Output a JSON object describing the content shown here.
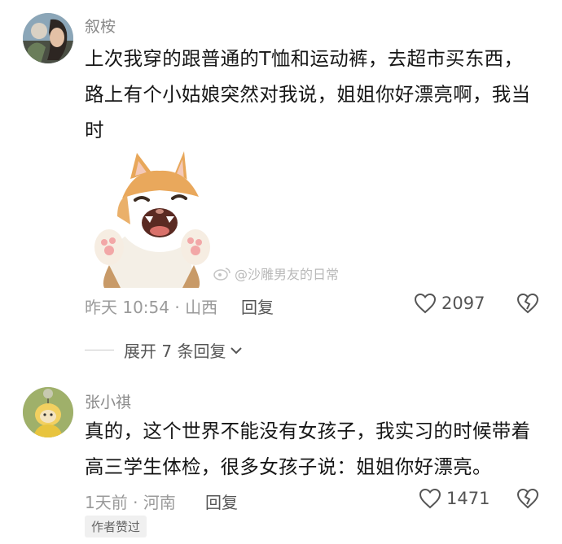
{
  "comments": [
    {
      "username": "叙桉",
      "text": "上次我穿的跟普通的T恤和运动裤，去超市买东西，路上有个小姑娘突然对我说，姐姐你好漂亮啊，我当时",
      "time": "昨天 10:54",
      "location": "山西",
      "reply_label": "回复",
      "likes": "2097",
      "has_sticker": true,
      "watermark": "@沙雕男友的日常",
      "expand_label": "展开 7 条回复"
    },
    {
      "username": "张小祺",
      "text": "真的，这个世界不能没有女孩子，我实习的时候带着高三学生体检，很多女孩子说：姐姐你好漂亮。",
      "time": "1天前",
      "location": "河南",
      "reply_label": "回复",
      "likes": "1471",
      "badge": "作者赞过"
    }
  ],
  "separator": "·",
  "icons": {
    "like": "heart-outline-icon",
    "dislike": "broken-heart-icon",
    "expand": "chevron-down-icon",
    "weibo": "weibo-logo-icon"
  }
}
